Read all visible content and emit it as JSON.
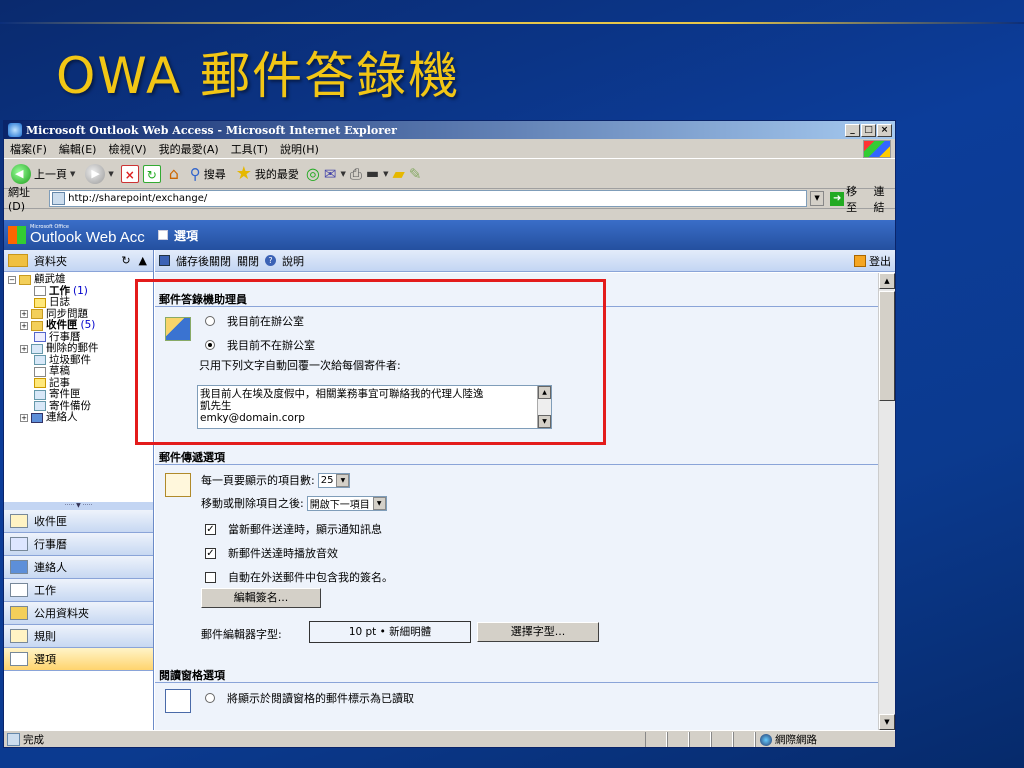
{
  "slide": {
    "title": "OWA 郵件答錄機"
  },
  "browser": {
    "title": "Microsoft Outlook Web Access - Microsoft Internet Explorer",
    "window_buttons": [
      "_",
      "□",
      "×"
    ],
    "menus": [
      "檔案(F)",
      "編輯(E)",
      "檢視(V)",
      "我的最愛(A)",
      "工具(T)",
      "說明(H)"
    ],
    "toolbar": {
      "back": "上一頁",
      "search": "搜尋",
      "favorites": "我的最愛"
    },
    "address": {
      "label": "網址(D)",
      "url": "http://sharepoint/exchange/",
      "go": "移至",
      "links": "連結"
    }
  },
  "owa": {
    "brand_small": "Microsoft Office",
    "brand": "Outlook Web Acc",
    "section_title": "選項",
    "folder_header": "資料夾",
    "tree": {
      "root": "顧武雄",
      "tasks": "工作",
      "tasks_count": "(1)",
      "journal": "日誌",
      "sync": "同步問題",
      "inbox": "收件匣",
      "inbox_count": "(5)",
      "calendar": "行事曆",
      "deleted": "刪除的郵件",
      "junk": "垃圾郵件",
      "drafts": "草稿",
      "notes": "記事",
      "sent": "寄件匣",
      "sent_backup": "寄件備份",
      "contacts": "連絡人"
    },
    "nav": [
      "收件匣",
      "行事曆",
      "連絡人",
      "工作",
      "公用資料夾",
      "規則",
      "選項"
    ],
    "actions": {
      "save_close": "儲存後關閉",
      "close": "關閉",
      "help": "說明",
      "logoff": "登出"
    },
    "oof": {
      "heading": "郵件答錄機助理員",
      "in_office": "我目前在辦公室",
      "out_office": "我目前不在辦公室",
      "instruction": "只用下列文字自動回覆一次給每個寄件者:",
      "message_line1": "我目前人在埃及度假中，相關業務事宜可聯絡我的代理人陸逸",
      "message_line2": "凱先生",
      "message_line3": "emky@domain.corp"
    },
    "messaging": {
      "heading": "郵件傳遞選項",
      "items_per_page_label": "每一頁要顯示的項目數:",
      "items_per_page_value": "25",
      "after_move_label": "移動或刪除項目之後:",
      "after_move_value": "開啟下一項目",
      "notify_new": "當新郵件送達時，顯示通知訊息",
      "sound_new": "新郵件送達時播放音效",
      "auto_signature": "自動在外送郵件中包含我的簽名。",
      "edit_signature": "編輯簽名...",
      "editor_font_label": "郵件編輯器字型:",
      "editor_font_value": "10 pt • 新細明體",
      "choose_font": "選擇字型..."
    },
    "reading": {
      "heading": "閱讀窗格選項",
      "mark_read": "將顯示於閱讀窗格的郵件標示為已讀取"
    }
  },
  "status": {
    "text": "完成",
    "zone": "網際網路"
  },
  "colors": {
    "slide_title": "#f2c615",
    "highlight": "#e31b1b",
    "owa_header": "#24509f"
  }
}
